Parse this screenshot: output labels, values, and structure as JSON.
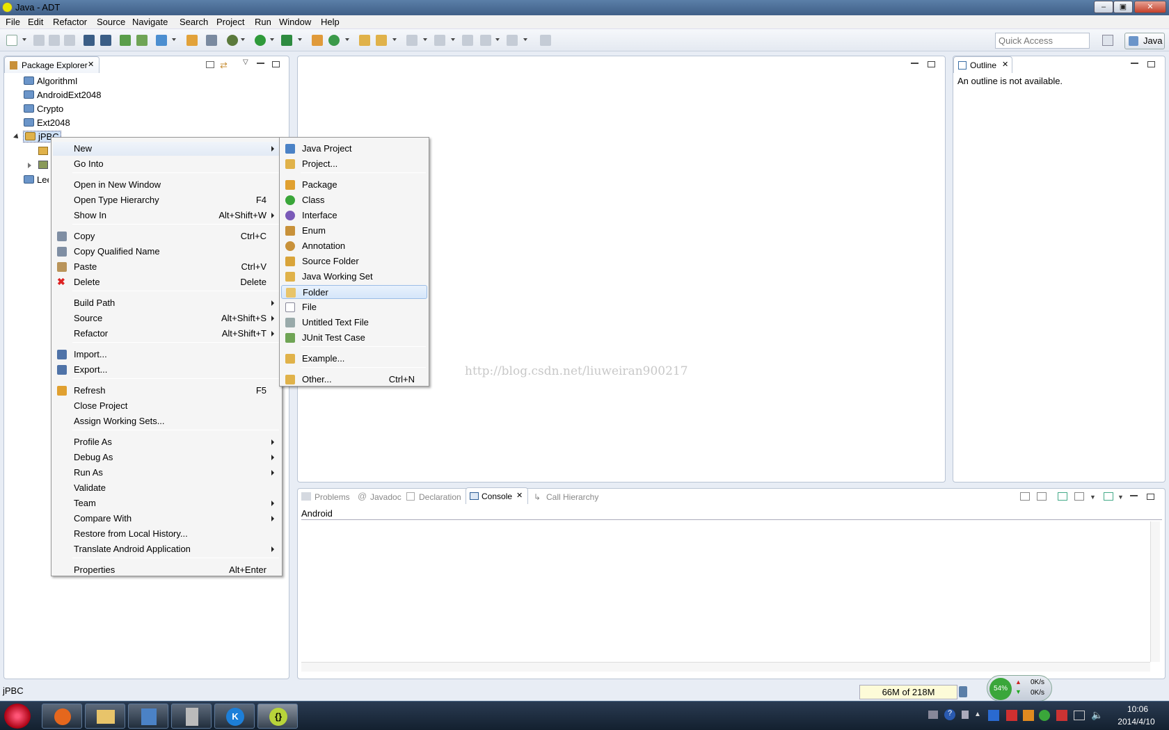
{
  "window": {
    "title": "Java - ADT"
  },
  "menubar": [
    "File",
    "Edit",
    "Refactor",
    "Source",
    "Navigate",
    "Search",
    "Project",
    "Run",
    "Window",
    "Help"
  ],
  "toolbar": {
    "quick_access_placeholder": "Quick Access",
    "perspective": "Java"
  },
  "package_explorer": {
    "tab": "Package Explorer",
    "projects": [
      "AlgorithmI",
      "AndroidExt2048",
      "Crypto",
      "Ext2048",
      "jPBC",
      "Lee"
    ]
  },
  "context_menu": {
    "items": [
      {
        "label": "New",
        "accel": "",
        "submenu": true
      },
      {
        "label": "Go Into",
        "accel": ""
      },
      {
        "label": "Open in New Window",
        "accel": ""
      },
      {
        "label": "Open Type Hierarchy",
        "accel": "F4"
      },
      {
        "label": "Show In",
        "accel": "Alt+Shift+W",
        "submenu": true
      },
      {
        "label": "Copy",
        "accel": "Ctrl+C"
      },
      {
        "label": "Copy Qualified Name",
        "accel": ""
      },
      {
        "label": "Paste",
        "accel": "Ctrl+V"
      },
      {
        "label": "Delete",
        "accel": "Delete"
      },
      {
        "label": "Build Path",
        "accel": "",
        "submenu": true
      },
      {
        "label": "Source",
        "accel": "Alt+Shift+S",
        "submenu": true
      },
      {
        "label": "Refactor",
        "accel": "Alt+Shift+T",
        "submenu": true
      },
      {
        "label": "Import...",
        "accel": ""
      },
      {
        "label": "Export...",
        "accel": ""
      },
      {
        "label": "Refresh",
        "accel": "F5"
      },
      {
        "label": "Close Project",
        "accel": ""
      },
      {
        "label": "Assign Working Sets...",
        "accel": ""
      },
      {
        "label": "Profile As",
        "accel": "",
        "submenu": true
      },
      {
        "label": "Debug As",
        "accel": "",
        "submenu": true
      },
      {
        "label": "Run As",
        "accel": "",
        "submenu": true
      },
      {
        "label": "Validate",
        "accel": ""
      },
      {
        "label": "Team",
        "accel": "",
        "submenu": true
      },
      {
        "label": "Compare With",
        "accel": "",
        "submenu": true
      },
      {
        "label": "Restore from Local History...",
        "accel": ""
      },
      {
        "label": "Translate Android Application",
        "accel": "",
        "submenu": true
      },
      {
        "label": "Properties",
        "accel": "Alt+Enter"
      }
    ]
  },
  "new_submenu": {
    "items": [
      {
        "label": "Java Project",
        "accel": ""
      },
      {
        "label": "Project...",
        "accel": ""
      },
      {
        "label": "Package",
        "accel": ""
      },
      {
        "label": "Class",
        "accel": ""
      },
      {
        "label": "Interface",
        "accel": ""
      },
      {
        "label": "Enum",
        "accel": ""
      },
      {
        "label": "Annotation",
        "accel": ""
      },
      {
        "label": "Source Folder",
        "accel": ""
      },
      {
        "label": "Java Working Set",
        "accel": ""
      },
      {
        "label": "Folder",
        "accel": "",
        "selected": true
      },
      {
        "label": "File",
        "accel": ""
      },
      {
        "label": "Untitled Text File",
        "accel": ""
      },
      {
        "label": "JUnit Test Case",
        "accel": ""
      },
      {
        "label": "Example...",
        "accel": ""
      },
      {
        "label": "Other...",
        "accel": "Ctrl+N"
      }
    ]
  },
  "watermark": "http://blog.csdn.net/liuweiran900217",
  "outline": {
    "tab": "Outline",
    "message": "An outline is not available."
  },
  "bottom_tabs": [
    "Problems",
    "Javadoc",
    "Declaration",
    "Console",
    "Call Hierarchy"
  ],
  "console": {
    "header": "Android"
  },
  "status": {
    "left": "jPBC",
    "heap": "66M of 218M"
  },
  "net_widget": {
    "percent": "54%",
    "up": "0K/s",
    "down": "0K/s"
  },
  "clock": {
    "time": "10:06",
    "date": "2014/4/10"
  }
}
